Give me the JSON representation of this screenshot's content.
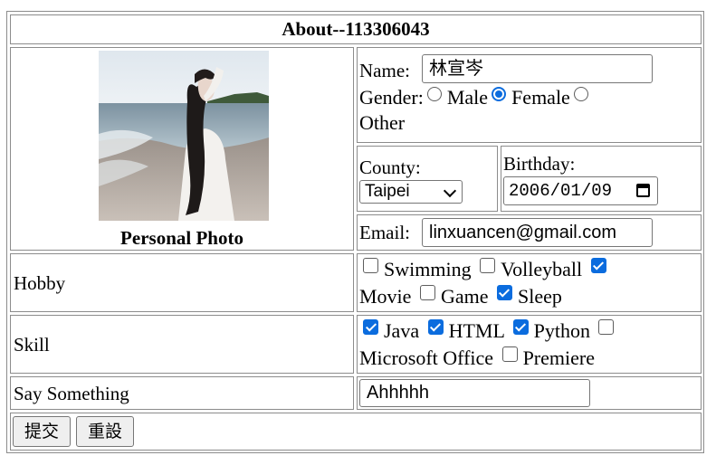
{
  "title": "About--113306043",
  "photo": {
    "caption": "Personal Photo"
  },
  "name": {
    "label": "Name:",
    "value": "林宣岑"
  },
  "gender": {
    "label": "Gender:",
    "options": [
      {
        "label": "Male",
        "selected": false
      },
      {
        "label": "Female",
        "selected": true
      },
      {
        "label": "Other",
        "selected": false
      }
    ]
  },
  "county": {
    "label": "County:",
    "value": "Taipei"
  },
  "birthday": {
    "label": "Birthday:",
    "value": "2006/01/09"
  },
  "email": {
    "label": "Email:",
    "value": "linxuancen@gmail.com"
  },
  "hobby": {
    "label": "Hobby",
    "options": [
      {
        "label": "Swimming",
        "checked": false
      },
      {
        "label": "Volleyball",
        "checked": false
      },
      {
        "label": "Movie",
        "checked": true
      },
      {
        "label": "Game",
        "checked": false
      },
      {
        "label": "Sleep",
        "checked": true
      }
    ]
  },
  "skill": {
    "label": "Skill",
    "options": [
      {
        "label": "Java",
        "checked": true
      },
      {
        "label": "HTML",
        "checked": true
      },
      {
        "label": "Python",
        "checked": true
      },
      {
        "label": "Microsoft Office",
        "checked": false
      },
      {
        "label": "Premiere",
        "checked": false
      }
    ]
  },
  "say_something": {
    "label": "Say Something",
    "value": "Ahhhhh"
  },
  "buttons": {
    "submit": "提交",
    "reset": "重設"
  },
  "colors": {
    "accent": "#0b6cde",
    "border": "#8c8c8c",
    "button_bg": "#efefef"
  }
}
